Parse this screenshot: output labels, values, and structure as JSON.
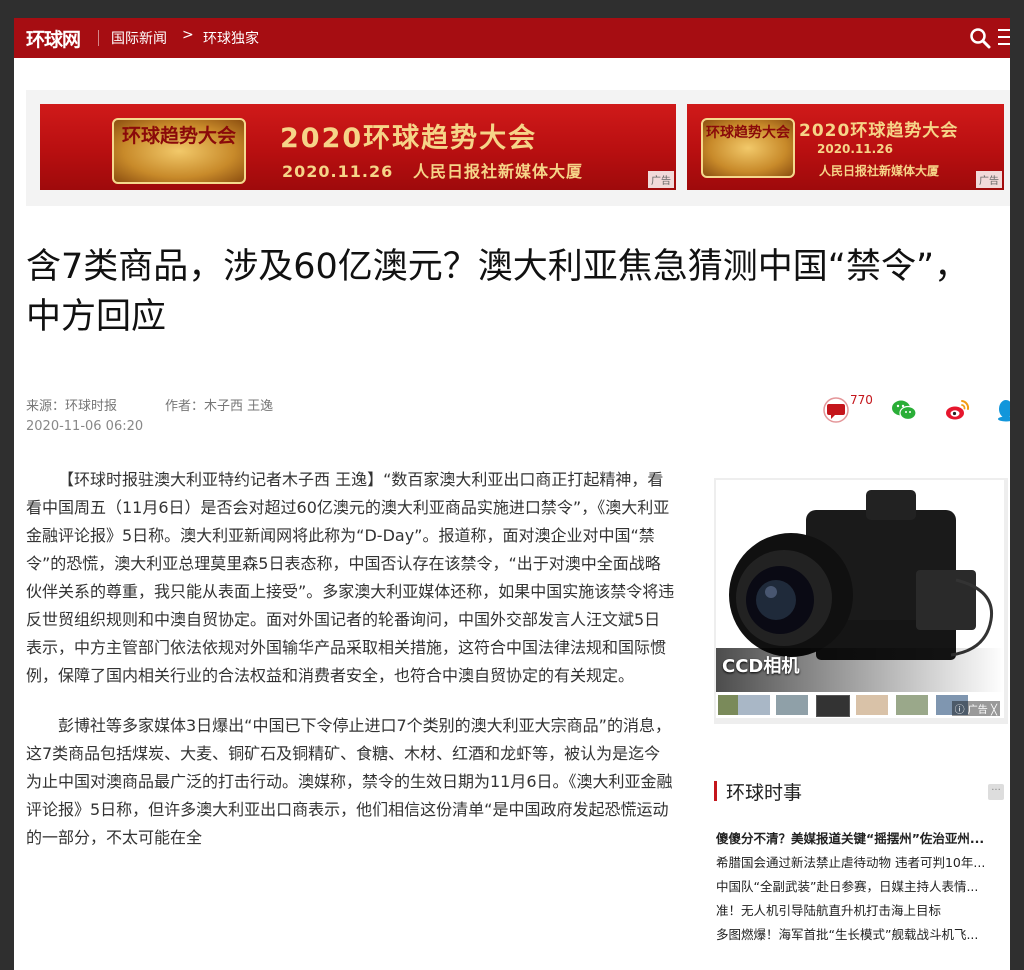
{
  "topbar": {
    "logo": "环球网",
    "breadcrumb": [
      "国际新闻",
      "环球独家"
    ],
    "breadcrumb_separator": ">",
    "icons": [
      "search-icon",
      "menu-icon"
    ]
  },
  "ads": [
    {
      "badge": "环球趋势大会",
      "badge_year": "2020",
      "title": "2020环球趋势大会",
      "date": "2020.11.26",
      "venue": "人民日报社新媒体大厦",
      "tag": "广告"
    },
    {
      "badge": "环球趋势大会",
      "title": "2020环球趋势大会",
      "date": "2020.11.26",
      "venue": "人民日报社新媒体大厦",
      "tag": "广告"
    }
  ],
  "article": {
    "title": "含7类商品，涉及60亿澳元？澳大利亚焦急猜测中国“禁令”，中方回应",
    "source": "来源：环球时报",
    "author": "作者：木子西 王逸",
    "time": "2020-11-06 06:20",
    "comment_count": "770",
    "paragraphs": [
      "【环球时报驻澳大利亚特约记者木子西 王逸】“数百家澳大利亚出口商正打起精神，看看中国周五（11月6日）是否会对超过60亿澳元的澳大利亚商品实施进口禁令”，《澳大利亚金融评论报》5日称。澳大利亚新闻网将此称为“D-Day”。报道称，面对澳企业对中国“禁令”的恐慌，澳大利亚总理莫里森5日表态称，中国否认存在该禁令，“出于对澳中全面战略伙伴关系的尊重，我只能从表面上接受”。多家澳大利亚媒体还称，如果中国实施该禁令将违反世贸组织规则和中澳自贸协定。面对外国记者的轮番询问，中国外交部发言人汪文斌5日表示，中方主管部门依法依规对外国输华产品采取相关措施，这符合中国法律法规和国际惯例，保障了国内相关行业的合法权益和消费者安全，也符合中澳自贸协定的有关规定。",
      "彭博社等多家媒体3日爆出“中国已下令停止进口7个类别的澳大利亚大宗商品”的消息，这7类商品包括煤炭、大麦、铜矿石及铜精矿、食糖、木材、红酒和龙虾等，被认为是迄今为止中国对澳商品最广泛的打击行动。澳媒称，禁令的生效日期为11月6日。《澳大利亚金融评论报》5日称，但许多澳大利亚出口商表示，他们相信这份清单“是中国政府发起恐慌运动的一部分，不太可能在全"
    ]
  },
  "sidebar_ad": {
    "label": "CCD相机",
    "close": "ⓘ 广告 ╳"
  },
  "news": {
    "title": "环球时事",
    "more": "···",
    "items": [
      {
        "text": "傻傻分不清？美媒报道关键“摇摆州”佐治亚州...",
        "bold": true
      },
      {
        "text": "希腊国会通过新法禁止虐待动物 违者可判10年...",
        "bold": false
      },
      {
        "text": "中国队“全副武装”赴日参赛，日媒主持人表情...",
        "bold": false
      },
      {
        "text": "准！无人机引导陆航直升机打击海上目标",
        "bold": false
      },
      {
        "text": "多图燃爆！海军首批“生长模式”舰载战斗机飞...",
        "bold": false
      }
    ]
  },
  "colors": {
    "brand_red": "#a60d12",
    "ad_red": "#c41515",
    "ad_gold": "#f6d488",
    "accent_red": "#c4161c",
    "wechat_green": "#2aae37"
  }
}
